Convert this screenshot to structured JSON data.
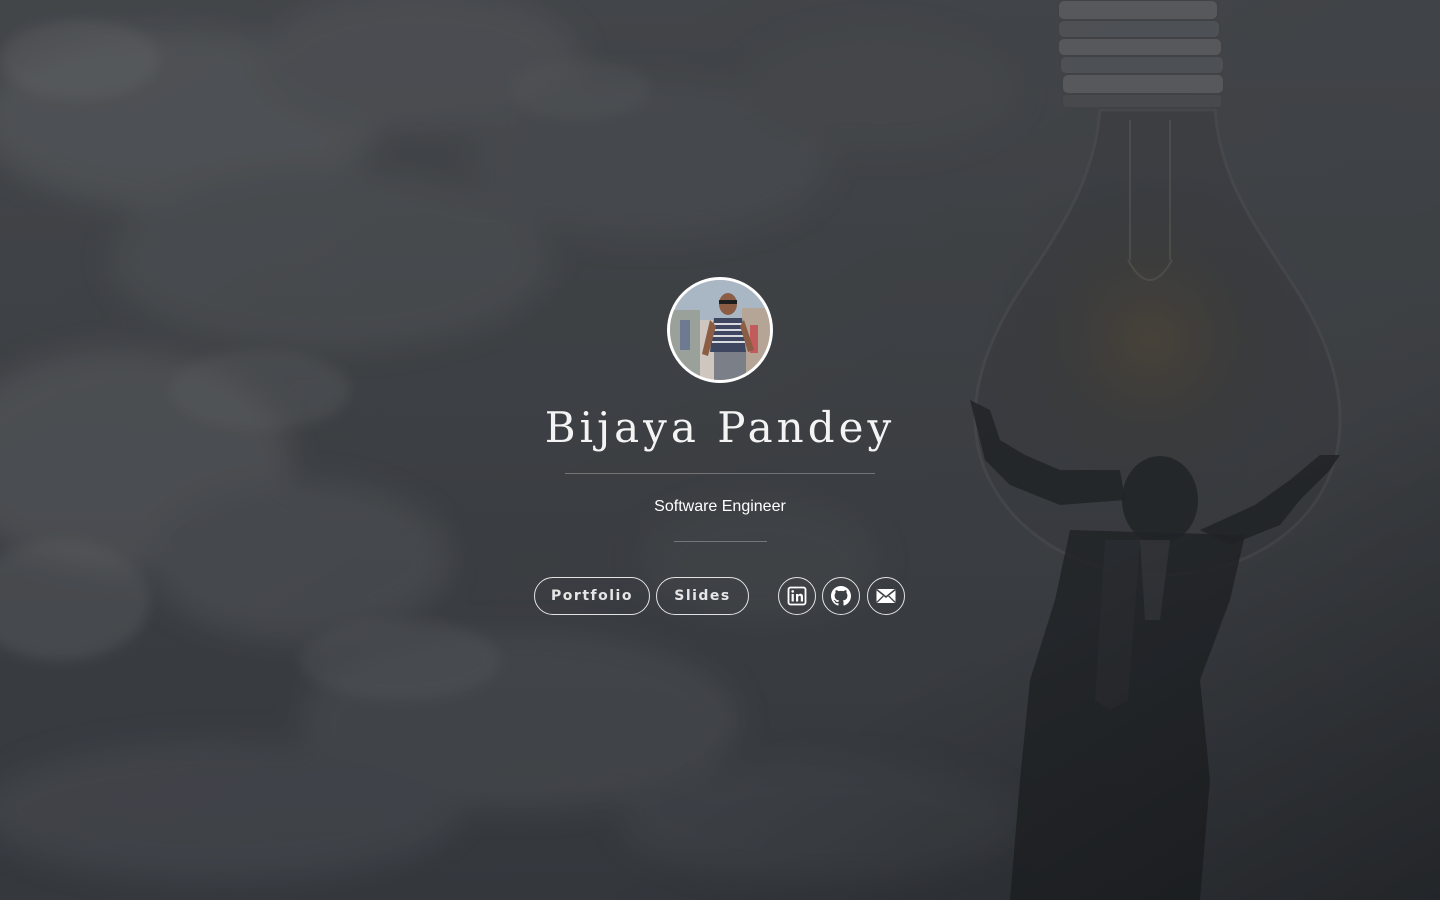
{
  "profile": {
    "name": "Bijaya Pandey",
    "title": "Software Engineer"
  },
  "buttons": {
    "portfolio": "Portfolio",
    "slides": "Slides"
  },
  "social": [
    {
      "icon": "linkedin-icon"
    },
    {
      "icon": "github-icon"
    },
    {
      "icon": "email-icon"
    }
  ],
  "colors": {
    "overlay": "#3a3d42",
    "text": "#ffffff",
    "border": "#ffffff"
  }
}
